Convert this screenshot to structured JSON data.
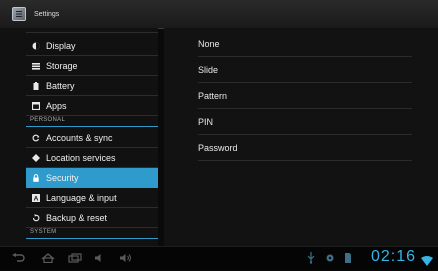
{
  "window": {
    "title": "Settings"
  },
  "sidebar": {
    "items": [
      {
        "label": "Display",
        "icon": "display-icon"
      },
      {
        "label": "Storage",
        "icon": "storage-icon"
      },
      {
        "label": "Battery",
        "icon": "battery-icon"
      },
      {
        "label": "Apps",
        "icon": "apps-icon"
      }
    ],
    "personal_header": "PERSONAL",
    "personal_items": [
      {
        "label": "Accounts & sync",
        "icon": "sync-icon"
      },
      {
        "label": "Location services",
        "icon": "location-icon"
      },
      {
        "label": "Security",
        "icon": "lock-icon",
        "selected": true
      },
      {
        "label": "Language & input",
        "icon": "language-icon"
      },
      {
        "label": "Backup & reset",
        "icon": "backup-icon"
      }
    ],
    "system_header": "SYSTEM"
  },
  "main": {
    "options": [
      "None",
      "Slide",
      "Pattern",
      "PIN",
      "Password"
    ]
  },
  "status_bar": {
    "time": "02:16"
  },
  "colors": {
    "accent": "#2f9bcc",
    "clock": "#33b5e5"
  }
}
